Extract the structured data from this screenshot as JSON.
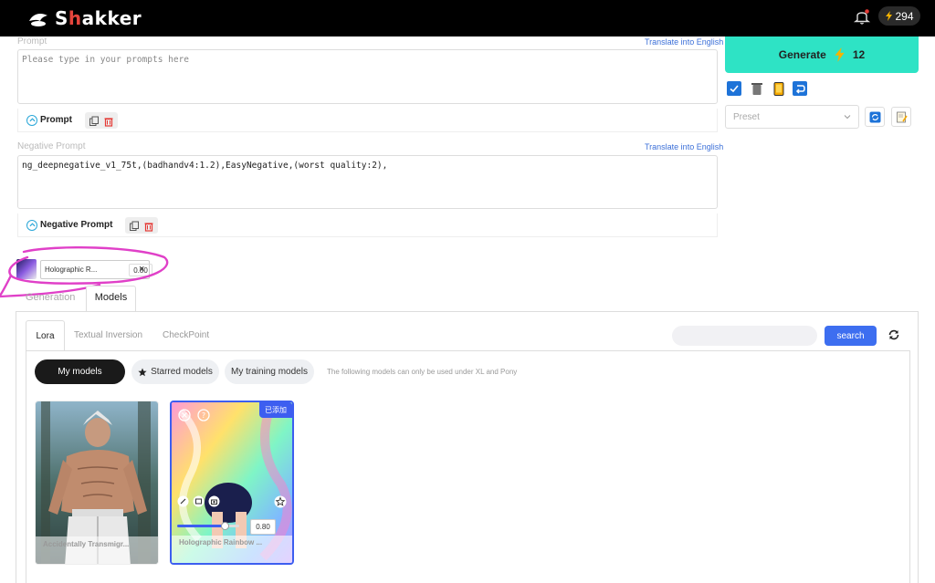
{
  "header": {
    "brand": "Shakker",
    "credits": "294"
  },
  "prompt": {
    "label": "Prompt",
    "translate": "Translate into English",
    "placeholder": "Please type in your prompts here",
    "toolbar_label": "Prompt"
  },
  "negative": {
    "label": "Negative Prompt",
    "translate": "Translate into English",
    "value": "ng_deepnegative_v1_75t,(badhandv4:1.2),EasyNegative,(worst quality:2),",
    "toolbar_label": "Negative Prompt"
  },
  "generate": {
    "label": "Generate",
    "cost": "12"
  },
  "preset": {
    "placeholder": "Preset"
  },
  "active_lora": {
    "name": "Holographic R...",
    "weight": "0.80",
    "remove": "×"
  },
  "tabs": [
    "Generation",
    "Models"
  ],
  "subtabs": [
    "Lora",
    "Textual Inversion",
    "CheckPoint"
  ],
  "search": {
    "button": "search"
  },
  "filters": {
    "my_models": "My models",
    "starred": "Starred models",
    "training": "My training models",
    "note": "The following models can only be used under XL and Pony"
  },
  "cards": [
    {
      "title": "Accidentally Transmigr..."
    },
    {
      "title": "Holographic Rainbow ...",
      "badge": "已添加",
      "weight": "0.80"
    }
  ],
  "colors": {
    "accent": "#2ee3c5",
    "primary": "#3d6ef0"
  }
}
